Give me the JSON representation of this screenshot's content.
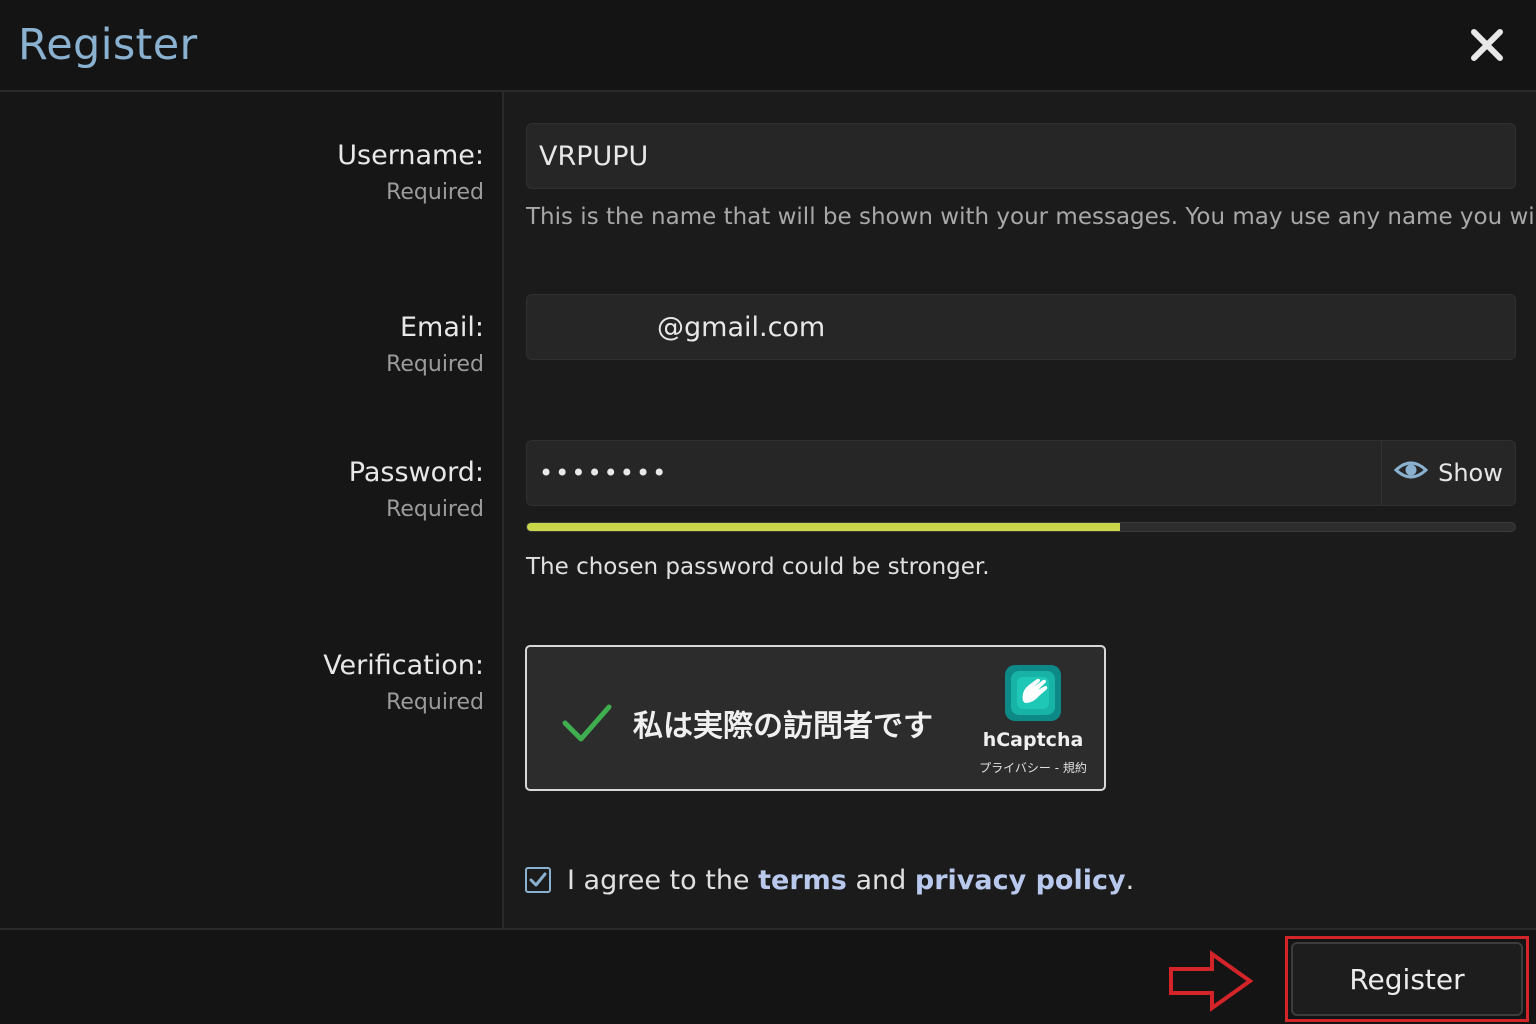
{
  "header": {
    "title": "Register"
  },
  "fields": {
    "username": {
      "label": "Username:",
      "required": "Required",
      "value": "VRPUPU",
      "hint": "This is the name that will be shown with your messages. You may use any name you wish."
    },
    "email": {
      "label": "Email:",
      "required": "Required",
      "value": "@gmail.com"
    },
    "password": {
      "label": "Password:",
      "required": "Required",
      "value": "••••••••",
      "show_label": "Show",
      "strength_percent": 60,
      "strength_message": "The chosen password could be stronger."
    },
    "verification": {
      "label": "Verification:",
      "required": "Required"
    }
  },
  "captcha": {
    "text": "私は実際の訪問者です",
    "brand": "hCaptcha",
    "links": "プライバシー - 規約",
    "check_color": "#3fae4f"
  },
  "agree": {
    "prefix": "I agree to the",
    "terms": "terms",
    "middle": "and",
    "privacy": "privacy policy",
    "suffix": ".",
    "checked": true
  },
  "footer": {
    "register_label": "Register"
  },
  "colors": {
    "accent": "#8ab1cf",
    "strength": "#c8d64a",
    "highlight": "#d3242a"
  }
}
